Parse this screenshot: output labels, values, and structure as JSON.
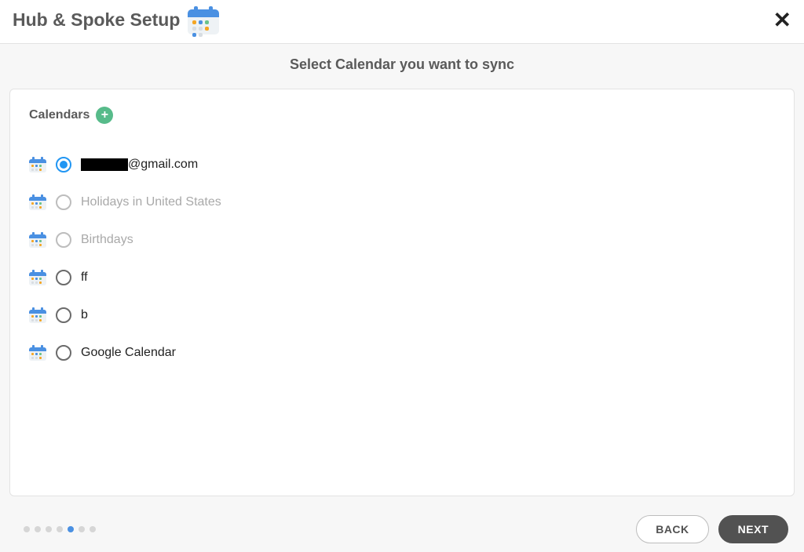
{
  "header": {
    "title": "Hub & Spoke Setup"
  },
  "subhead": "Select Calendar you want to sync",
  "section": {
    "title": "Calendars"
  },
  "items": [
    {
      "label": "@gmail.com",
      "redacted_prefix": true,
      "selected": true,
      "disabled": false
    },
    {
      "label": "Holidays in United States",
      "redacted_prefix": false,
      "selected": false,
      "disabled": true
    },
    {
      "label": "Birthdays",
      "redacted_prefix": false,
      "selected": false,
      "disabled": true
    },
    {
      "label": "ff",
      "redacted_prefix": false,
      "selected": false,
      "disabled": false
    },
    {
      "label": "b",
      "redacted_prefix": false,
      "selected": false,
      "disabled": false
    },
    {
      "label": "Google Calendar",
      "redacted_prefix": false,
      "selected": false,
      "disabled": false
    }
  ],
  "stepper": {
    "total": 7,
    "active_index": 4
  },
  "buttons": {
    "back": "BACK",
    "next": "NEXT"
  }
}
